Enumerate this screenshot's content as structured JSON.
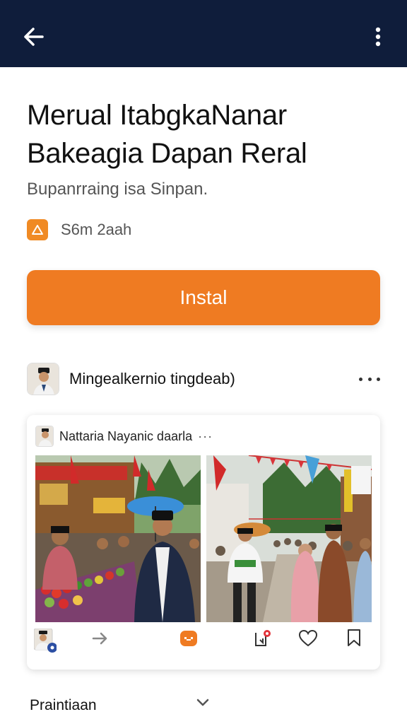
{
  "header": {
    "back_icon": "arrow-left-icon",
    "menu_icon": "vertical-dots-icon",
    "background": "#0f1d3b"
  },
  "app": {
    "title_line1": "Merual ItabgkaNanar",
    "title_line2": "Bakeagia Dapan Reral",
    "subtitle": "Bupanrraing isa Sinpan.",
    "meta_text": "S6m 2aah",
    "meta_badge_color": "#f08a24",
    "install_label": "Instal",
    "install_color": "#ef7b22"
  },
  "post": {
    "author": "Mingealkernio tingdeab)",
    "card": {
      "author": "Nattaria Nayanic daarla",
      "author_suffix": "···",
      "photo_left_sign": "",
      "photo_right_shirt": "",
      "actions": [
        "share-icon",
        "comment-icon",
        "bookmark-plus-icon",
        "heart-icon",
        "bookmark-icon"
      ]
    }
  },
  "footer": {
    "label": "Praintiaan",
    "chevron_icon": "chevron-down-icon"
  }
}
